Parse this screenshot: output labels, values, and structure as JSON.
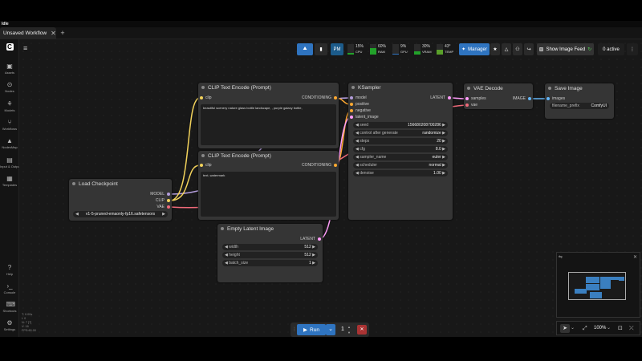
{
  "app": {
    "brand": "Idle"
  },
  "tabs": [
    {
      "label": "Unsaved Workflow",
      "close": "✕"
    }
  ],
  "new_tab": "+",
  "sidebar": {
    "items": [
      {
        "label": "Assets",
        "icon": "assets-icon"
      },
      {
        "label": "Nodes",
        "icon": "nodes-icon"
      },
      {
        "label": "Models",
        "icon": "models-icon"
      },
      {
        "label": "Workflows",
        "icon": "workflows-icon"
      },
      {
        "label": "NodesMap",
        "icon": "nodesmap-icon"
      },
      {
        "label": "Input & Outputs",
        "icon": "input-outputs-icon"
      },
      {
        "label": "Templates",
        "icon": "templates-icon"
      },
      {
        "label": "Help",
        "icon": "help-icon"
      },
      {
        "label": "Console",
        "icon": "console-icon"
      },
      {
        "label": "Shortcuts",
        "icon": "shortcuts-icon"
      },
      {
        "label": "Settings",
        "icon": "settings-icon"
      }
    ]
  },
  "toolbar": {
    "pm": "PM",
    "gauges": [
      {
        "label": "CPU",
        "value": "15%",
        "level": 15
      },
      {
        "label": "RAM",
        "value": "60%",
        "level": 60
      },
      {
        "label": "GPU",
        "value": "9%",
        "level": 9
      },
      {
        "label": "VRAM",
        "value": "30%",
        "level": 30
      },
      {
        "label": "TEMP",
        "value": "43°",
        "level": 43
      }
    ],
    "manager": "Manager",
    "show_image_feed": "Show Image Feed",
    "active": "0 active"
  },
  "nodes": {
    "clip1": {
      "title": "CLIP Text Encode (Prompt)",
      "in": "clip",
      "out": "CONDITIONING",
      "text": "beautiful scenery nature glass bottle landscape, , purple galaxy bottle,"
    },
    "clip2": {
      "title": "CLIP Text Encode (Prompt)",
      "in": "clip",
      "out": "CONDITIONING",
      "text": "text, watermark"
    },
    "ksampler": {
      "title": "KSampler",
      "inputs": [
        "model",
        "positive",
        "negative",
        "latent_image"
      ],
      "out": "LATENT",
      "widgets": [
        {
          "name": "seed",
          "value": "156680208700286"
        },
        {
          "name": "control after generate",
          "value": "randomize"
        },
        {
          "name": "steps",
          "value": "20"
        },
        {
          "name": "cfg",
          "value": "8.0"
        },
        {
          "name": "sampler_name",
          "value": "euler"
        },
        {
          "name": "scheduler",
          "value": "normal"
        },
        {
          "name": "denoise",
          "value": "1.00"
        }
      ]
    },
    "vae": {
      "title": "VAE Decode",
      "inputs": [
        "samples",
        "vae"
      ],
      "out": "IMAGE"
    },
    "save": {
      "title": "Save Image",
      "in": "images",
      "w_name": "filename_prefix",
      "w_value": "ComfyUI"
    },
    "checkpoint": {
      "title": "Load Checkpoint",
      "outs": [
        "MODEL",
        "CLIP",
        "VAE"
      ],
      "ckpt": "v1-5-pruned-emaonly-fp16.safetensors"
    },
    "latent": {
      "title": "Empty Latent Image",
      "out": "LATENT",
      "widgets": [
        {
          "name": "width",
          "value": "512"
        },
        {
          "name": "height",
          "value": "512"
        },
        {
          "name": "batch_size",
          "value": "1"
        }
      ]
    }
  },
  "run": {
    "label": "Run",
    "count": "1"
  },
  "zoom": {
    "value": "100%"
  },
  "stats": [
    "T: 0.00s",
    "I: 0",
    "N: 7 [7]",
    "V: 16",
    "FPS:60.00"
  ],
  "colors": {
    "accent": "#2f74c0",
    "clip_yellow": "#f2d25b",
    "model_purple": "#b39ddb",
    "vae_red": "#f06a7a",
    "latent_pink": "#ff9cf9",
    "conditioning": "#ffa931"
  }
}
